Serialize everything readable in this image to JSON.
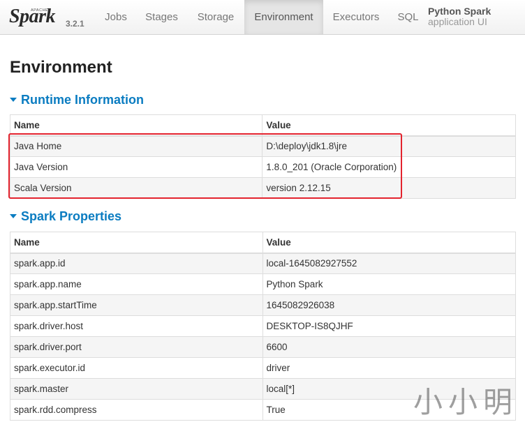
{
  "navbar": {
    "brand": {
      "apache": "APACHE",
      "spark": "Spark",
      "version": "3.2.1"
    },
    "tabs": [
      {
        "label": "Jobs",
        "active": false
      },
      {
        "label": "Stages",
        "active": false
      },
      {
        "label": "Storage",
        "active": false
      },
      {
        "label": "Environment",
        "active": true
      },
      {
        "label": "Executors",
        "active": false
      },
      {
        "label": "SQL",
        "active": false
      }
    ],
    "app_name": {
      "line1": "Python Spark",
      "line2": "application UI"
    }
  },
  "page": {
    "title": "Environment"
  },
  "runtime": {
    "title": "Runtime Information",
    "headers": {
      "name": "Name",
      "value": "Value"
    },
    "rows": [
      {
        "name": "Java Home",
        "value": "D:\\deploy\\jdk1.8\\jre"
      },
      {
        "name": "Java Version",
        "value": "1.8.0_201 (Oracle Corporation)"
      },
      {
        "name": "Scala Version",
        "value": "version 2.12.15"
      }
    ]
  },
  "spark_properties": {
    "title": "Spark Properties",
    "headers": {
      "name": "Name",
      "value": "Value"
    },
    "rows": [
      {
        "name": "spark.app.id",
        "value": "local-1645082927552"
      },
      {
        "name": "spark.app.name",
        "value": "Python Spark"
      },
      {
        "name": "spark.app.startTime",
        "value": "1645082926038"
      },
      {
        "name": "spark.driver.host",
        "value": "DESKTOP-IS8QJHF"
      },
      {
        "name": "spark.driver.port",
        "value": "6600"
      },
      {
        "name": "spark.executor.id",
        "value": "driver"
      },
      {
        "name": "spark.master",
        "value": "local[*]"
      },
      {
        "name": "spark.rdd.compress",
        "value": "True"
      }
    ]
  },
  "watermark": "小小明",
  "colors": {
    "accent": "#0a7cc1",
    "highlight": "#e3232e",
    "logo_star": "#e25a1c"
  }
}
